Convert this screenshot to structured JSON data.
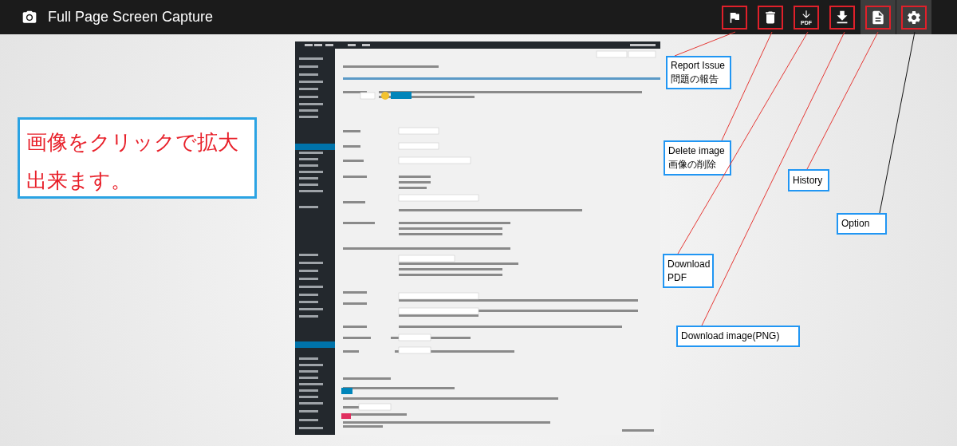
{
  "app": {
    "title": "Full Page Screen Capture"
  },
  "toolbar": [
    {
      "kind": "flag",
      "highlighted": false
    },
    {
      "kind": "trash",
      "highlighted": false
    },
    {
      "kind": "pdf",
      "label": "PDF",
      "highlighted": false
    },
    {
      "kind": "download",
      "highlighted": false
    },
    {
      "kind": "history",
      "highlighted": true
    },
    {
      "kind": "settings",
      "highlighted": true
    }
  ],
  "note": {
    "text": "画像をクリックで拡大出来ます。"
  },
  "callouts": [
    {
      "lines": [
        "Report Issue",
        "問題の報告"
      ]
    },
    {
      "lines": [
        "Delete image",
        "画像の削除"
      ]
    },
    {
      "lines": [
        "History"
      ]
    },
    {
      "lines": [
        "Option"
      ]
    },
    {
      "lines": [
        "Download",
        "PDF"
      ]
    },
    {
      "lines": [
        "Download image(PNG)"
      ]
    }
  ]
}
